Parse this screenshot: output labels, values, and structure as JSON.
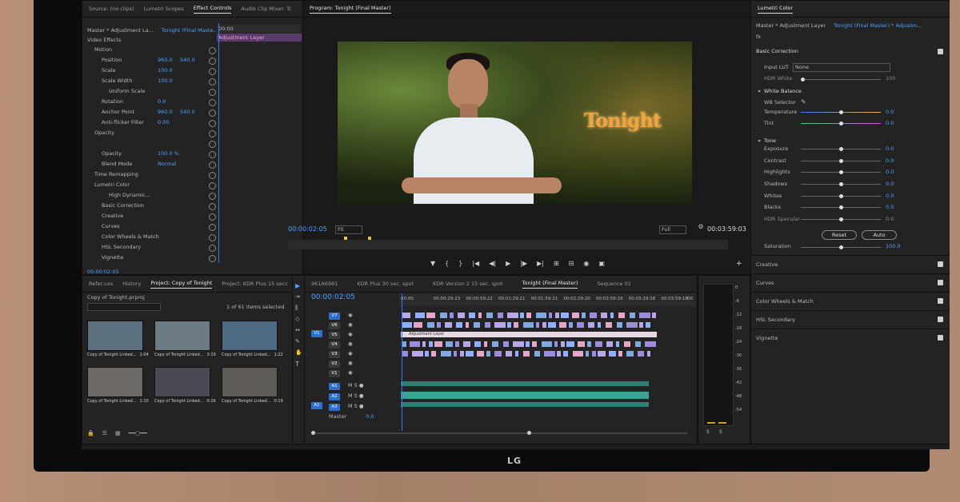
{
  "device": {
    "brand": "LG"
  },
  "source_panel": {
    "tabs": [
      "Source: (no clips)",
      "Lumetri Scopes",
      "Effect Controls",
      "Audio Clip Mixer: Tc"
    ],
    "active_tab": "Effect Controls",
    "clip_path": "Master * Adjustment La...",
    "sequence": "Tonight (Final Maste...",
    "timecode_start": "00:00",
    "adjustment_label": "Adjustment Layer",
    "section_label": "Video Effects",
    "rows": [
      {
        "label": "Motion",
        "indent": 1,
        "value1": "",
        "value2": ""
      },
      {
        "label": "Position",
        "indent": 2,
        "value1": "960.0",
        "value2": "540.0"
      },
      {
        "label": "Scale",
        "indent": 2,
        "value1": "100.0",
        "value2": ""
      },
      {
        "label": "Scale Width",
        "indent": 2,
        "value1": "100.0",
        "value2": ""
      },
      {
        "label": "Uniform Scale",
        "indent": 3,
        "value1": "",
        "value2": ""
      },
      {
        "label": "Rotation",
        "indent": 2,
        "value1": "0.0",
        "value2": ""
      },
      {
        "label": "Anchor Point",
        "indent": 2,
        "value1": "960.0",
        "value2": "540.0"
      },
      {
        "label": "Anti-flicker Filter",
        "indent": 2,
        "value1": "0.00",
        "value2": ""
      },
      {
        "label": "Opacity",
        "indent": 1,
        "value1": "",
        "value2": ""
      },
      {
        "label": "",
        "indent": 2,
        "value1": "",
        "value2": ""
      },
      {
        "label": "Opacity",
        "indent": 2,
        "value1": "100.0 %",
        "value2": ""
      },
      {
        "label": "Blend Mode",
        "indent": 2,
        "value1": "Normal",
        "value2": ""
      },
      {
        "label": "Time Remapping",
        "indent": 1,
        "value1": "",
        "value2": ""
      },
      {
        "label": "Lumetri Color",
        "indent": 1,
        "value1": "",
        "value2": ""
      },
      {
        "label": "High Dynamic...",
        "indent": 3,
        "value1": "",
        "value2": ""
      },
      {
        "label": "Basic Correction",
        "indent": 2,
        "value1": "",
        "value2": ""
      },
      {
        "label": "Creative",
        "indent": 2,
        "value1": "",
        "value2": ""
      },
      {
        "label": "Curves",
        "indent": 2,
        "value1": "",
        "value2": ""
      },
      {
        "label": "Color Wheels & Match",
        "indent": 2,
        "value1": "",
        "value2": ""
      },
      {
        "label": "HSL Secondary",
        "indent": 2,
        "value1": "",
        "value2": ""
      },
      {
        "label": "Vignette",
        "indent": 2,
        "value1": "",
        "value2": ""
      }
    ],
    "footer_timecode": "00:00:02:05"
  },
  "program_monitor": {
    "title": "Program: Tonight (Final Master)",
    "overlay_text": "Tonight",
    "current_timecode": "00:00:02:05",
    "fit_label": "Fit",
    "quality_label": "Full",
    "duration": "00:03:59:03"
  },
  "project_panel": {
    "tabs": [
      "Refer:ces",
      "History",
      "Project: Copy of Tonight",
      "Project: KDR Plus 15 secc"
    ],
    "active_tab": "Project: Copy of Tonight",
    "project_file": "Copy of Tonight.prproj",
    "items_count": "1 of 61 items selected",
    "thumbnails": [
      {
        "name": "Copy of Tonight Linked...",
        "dur": "1:04"
      },
      {
        "name": "Copy of Tonight Linked...",
        "dur": "3:19"
      },
      {
        "name": "Copy of Tonight Linked...",
        "dur": "1:22"
      },
      {
        "name": "Copy of Tonight Linked...",
        "dur": "1:10"
      },
      {
        "name": "Copy of Tonight Linked...",
        "dur": "0:16"
      },
      {
        "name": "Copy of Tonight Linked...",
        "dur": "0:19"
      }
    ]
  },
  "timeline": {
    "tabs": [
      "961A6981",
      "KDR Plus 30 sec. spot",
      "KDR Version 2 15 sec. spot",
      "Tonight (Final Master)",
      "Sequence 01"
    ],
    "active_tab": "Tonight (Final Master)",
    "timecode": "00:00:02:05",
    "ruler": [
      "00:00",
      "00:00:29:23",
      "00:00:59:22",
      "00:01:29:21",
      "00:01:59:21",
      "00:02:29:20",
      "00:02:59:19",
      "00:03:29:18",
      "00:03:59:18",
      "00"
    ],
    "video_tracks": [
      "V7",
      "V6",
      "V5",
      "V4",
      "V3",
      "V2",
      "V1"
    ],
    "audio_tracks": [
      "A1",
      "A2",
      "A3"
    ],
    "adjustment_clip": "Adjustment Layer",
    "master_label": "Master",
    "master_value": "0.0",
    "source_patch_v": "V1",
    "source_patch_a": "A1",
    "meter_scale": [
      "0",
      "-6",
      "-12",
      "-18",
      "-24",
      "-30",
      "-36",
      "-42",
      "-48",
      "-54"
    ],
    "meter_solo": [
      "S",
      "S"
    ]
  },
  "lumetri": {
    "title": "Lumetri Color",
    "clip_path": "Master * Adjustment Layer",
    "sequence": "Tonight (Final Master) * Adjustm...",
    "fx_label": "fx",
    "basic_correction": "Basic Correction",
    "input_lut_label": "Input LUT",
    "input_lut_value": "None",
    "hdr_white_label": "HDR White",
    "hdr_white_value": "100",
    "white_balance": "White Balance",
    "wb_selector": "WB Selector",
    "tone": "Tone",
    "sliders": [
      {
        "label": "Temperature",
        "value": "0.0",
        "pos": 0.5,
        "type": "temp"
      },
      {
        "label": "Tint",
        "value": "0.0",
        "pos": 0.5,
        "type": "tint"
      },
      {
        "label": "Exposure",
        "value": "0.0",
        "pos": 0.5,
        "type": "tone"
      },
      {
        "label": "Contrast",
        "value": "0.0",
        "pos": 0.5,
        "type": "tone"
      },
      {
        "label": "Highlights",
        "value": "0.0",
        "pos": 0.5,
        "type": "tone"
      },
      {
        "label": "Shadows",
        "value": "0.0",
        "pos": 0.5,
        "type": "tone"
      },
      {
        "label": "Whites",
        "value": "0.0",
        "pos": 0.5,
        "type": "tone"
      },
      {
        "label": "Blacks",
        "value": "0.0",
        "pos": 0.5,
        "type": "tone"
      },
      {
        "label": "HDR Specular",
        "value": "0.0",
        "pos": 0.5,
        "type": "dim"
      }
    ],
    "reset_label": "Reset",
    "auto_label": "Auto",
    "saturation_label": "Saturation",
    "saturation_value": "100.0",
    "sections": [
      "Creative",
      "Curves",
      "Color Wheels & Match",
      "HSL Secondary",
      "Vignette"
    ]
  }
}
